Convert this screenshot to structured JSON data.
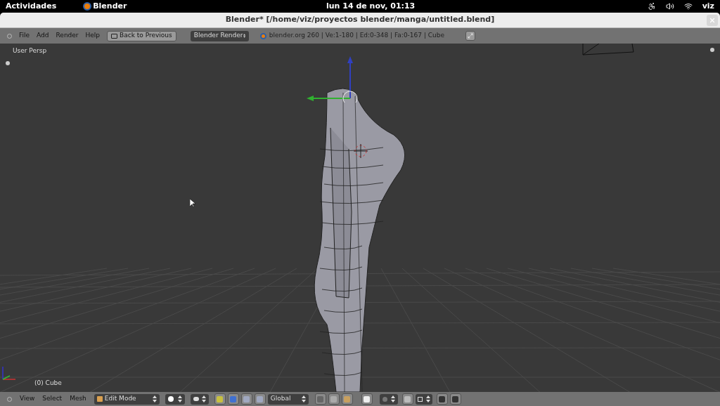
{
  "top_bar": {
    "activities": "Actividades",
    "app_name": "Blender",
    "clock": "lun 14 de nov, 01:13",
    "user": "viz"
  },
  "window": {
    "title": "Blender* [/home/viz/proyectos blender/manga/untitled.blend]"
  },
  "info_header": {
    "menus": [
      "File",
      "Add",
      "Render",
      "Help"
    ],
    "back_button": "Back to Previous",
    "render_engine": "Blender Render",
    "stats": "blender.org 260 | Ve:1-180 | Ed:0-348 | Fa:0-167 | Cube"
  },
  "viewport": {
    "view_label": "User Persp",
    "object_label": "(0) Cube"
  },
  "view3d_header": {
    "menus": [
      "View",
      "Select",
      "Mesh"
    ],
    "mode": "Edit Mode",
    "orientation": "Global"
  }
}
